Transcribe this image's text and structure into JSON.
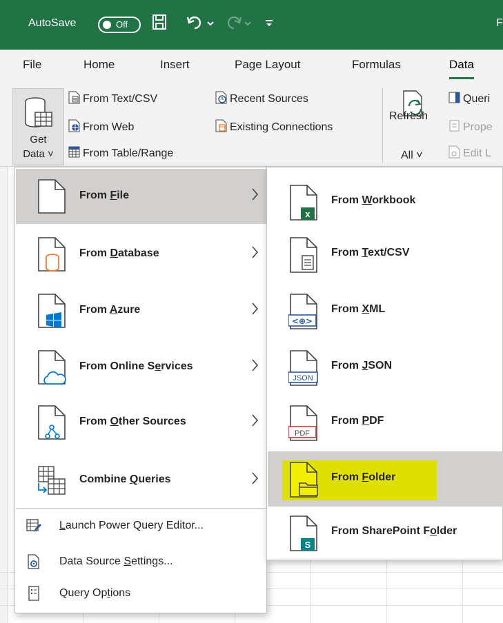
{
  "titlebar": {
    "autosave_label": "AutoSave",
    "autosave_state": "Off",
    "title_partial": "F",
    "bg_color": "#217346"
  },
  "tabs": [
    "File",
    "Home",
    "Insert",
    "Page Layout",
    "Formulas",
    "Data"
  ],
  "active_tab": "Data",
  "ribbon": {
    "get_data_line1": "Get",
    "get_data_line2": "Data ˅",
    "from_text_csv": "From Text/CSV",
    "from_web": "From Web",
    "from_table_range": "From Table/Range",
    "recent_sources": "Recent Sources",
    "existing_connections": "Existing Connections",
    "refresh_line1": "Refresh",
    "refresh_line2": "All ˅",
    "queries_partial": "Queri",
    "properties_partial": "Prope",
    "edit_links_partial": "Edit L"
  },
  "left_menu": {
    "items": [
      {
        "pre": "From ",
        "ul": "F",
        "post": "ile",
        "icon": "file-icon"
      },
      {
        "pre": "From ",
        "ul": "D",
        "post": "atabase",
        "icon": "database-icon"
      },
      {
        "pre": "From ",
        "ul": "A",
        "post": "zure",
        "icon": "azure-icon"
      },
      {
        "pre": "From Online S",
        "ul": "e",
        "post": "rvices",
        "icon": "online-services-icon"
      },
      {
        "pre": "From ",
        "ul": "O",
        "post": "ther Sources",
        "icon": "other-sources-icon"
      },
      {
        "pre": "Combine ",
        "ul": "Q",
        "post": "ueries",
        "icon": "combine-queries-icon"
      }
    ],
    "bottom": [
      {
        "pre": "",
        "ul": "L",
        "post": "aunch Power Query Editor...",
        "icon": "power-query-editor-icon"
      },
      {
        "pre": "Data Source ",
        "ul": "S",
        "post": "ettings...",
        "icon": "data-source-settings-icon"
      },
      {
        "pre": "Query Op",
        "ul": "t",
        "post": "ions",
        "icon": "query-options-icon"
      }
    ]
  },
  "right_menu": {
    "items": [
      {
        "pre": "From ",
        "ul": "W",
        "post": "orkbook",
        "icon": "workbook-icon"
      },
      {
        "pre": "From ",
        "ul": "T",
        "post": "ext/CSV",
        "icon": "text-csv-icon"
      },
      {
        "pre": "From ",
        "ul": "X",
        "post": "ML",
        "icon": "xml-icon"
      },
      {
        "pre": "From ",
        "ul": "J",
        "post": "SON",
        "icon": "json-icon"
      },
      {
        "pre": "From ",
        "ul": "P",
        "post": "DF",
        "icon": "pdf-icon"
      },
      {
        "pre": "From ",
        "ul": "F",
        "post": "older",
        "icon": "folder-icon"
      },
      {
        "pre": "From SharePoint F",
        "ul": "o",
        "post": "lder",
        "icon": "sharepoint-folder-icon"
      }
    ],
    "icon_text": {
      "xml": "<⊕>",
      "json": "JSON",
      "pdf": "PDF",
      "excel": "x",
      "sharepoint": "S"
    }
  },
  "colors": {
    "excel_green": "#217346",
    "selected_bg": "#d2d0ce",
    "highlight": "#e0e000",
    "blue": "#2b579a",
    "orange": "#ed7d31",
    "pdf_red": "#d13438"
  }
}
